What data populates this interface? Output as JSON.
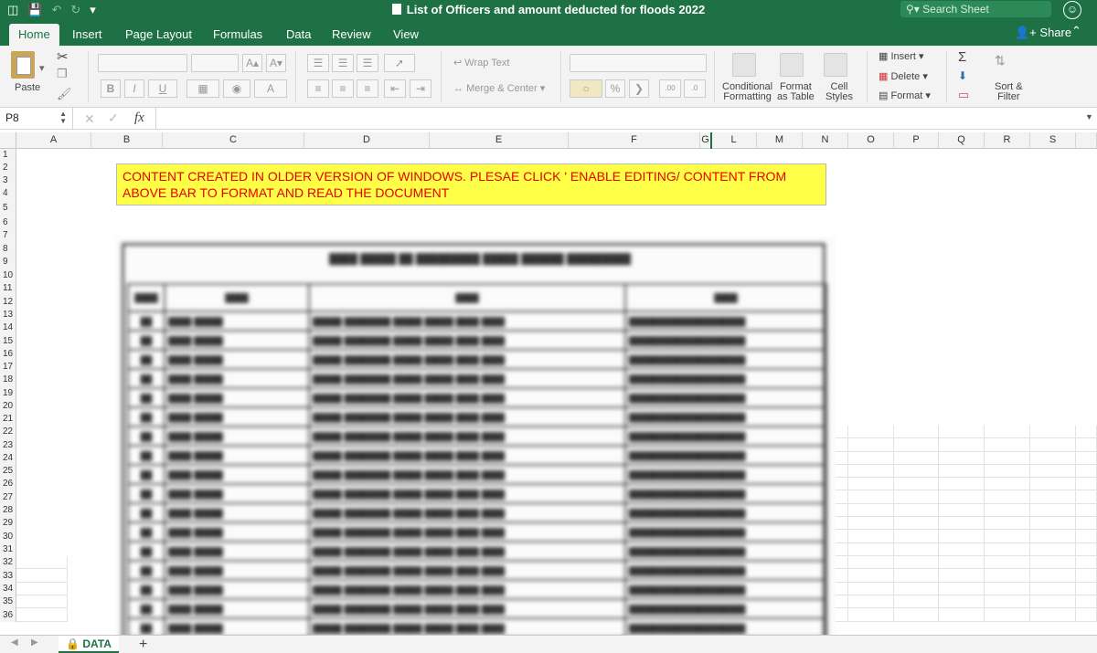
{
  "window": {
    "title": "List of Officers and amount deducted for floods 2022",
    "search_placeholder": "Search Sheet"
  },
  "ribbon_tabs": [
    "Home",
    "Insert",
    "Page Layout",
    "Formulas",
    "Data",
    "Review",
    "View"
  ],
  "active_tab": "Home",
  "share_label": "Share",
  "ribbon": {
    "paste": "Paste",
    "wrap_text": "Wrap Text",
    "merge_center": "Merge & Center",
    "conditional_formatting": [
      "Conditional",
      "Formatting"
    ],
    "format_as_table": [
      "Format",
      "as Table"
    ],
    "cell_styles": [
      "Cell",
      "Styles"
    ],
    "insert": "Insert",
    "delete": "Delete",
    "format": "Format",
    "sort_filter": [
      "Sort &",
      "Filter"
    ],
    "bold": "B",
    "italic": "I",
    "underline": "U",
    "percent": "%"
  },
  "formula_bar": {
    "name_box": "P8",
    "fx_label": "fx",
    "value": ""
  },
  "columns": [
    "A",
    "B",
    "C",
    "D",
    "E",
    "F",
    "G",
    "L",
    "M",
    "N",
    "O",
    "P",
    "Q",
    "R",
    "S"
  ],
  "rows": [
    "1",
    "2",
    "3",
    "4",
    "5",
    "6",
    "7",
    "8",
    "9",
    "10",
    "11",
    "12",
    "13",
    "14",
    "15",
    "16",
    "17",
    "18",
    "19",
    "20",
    "21",
    "22",
    "23",
    "24",
    "25",
    "26",
    "27",
    "28",
    "29",
    "30",
    "31",
    "32",
    "33",
    "34",
    "35",
    "36"
  ],
  "notice_text": "CONTENT CREATED IN OLDER VERSION OF WINDOWS. PLESAE CLICK ' ENABLE EDITING/ CONTENT FROM ABOVE BAR TO FORMAT AND READ THE DOCUMENT",
  "sheet_tab": "DATA",
  "colors": {
    "excel_green": "#1e7145",
    "notice_bg": "#ffff47",
    "notice_text": "#e60000"
  }
}
